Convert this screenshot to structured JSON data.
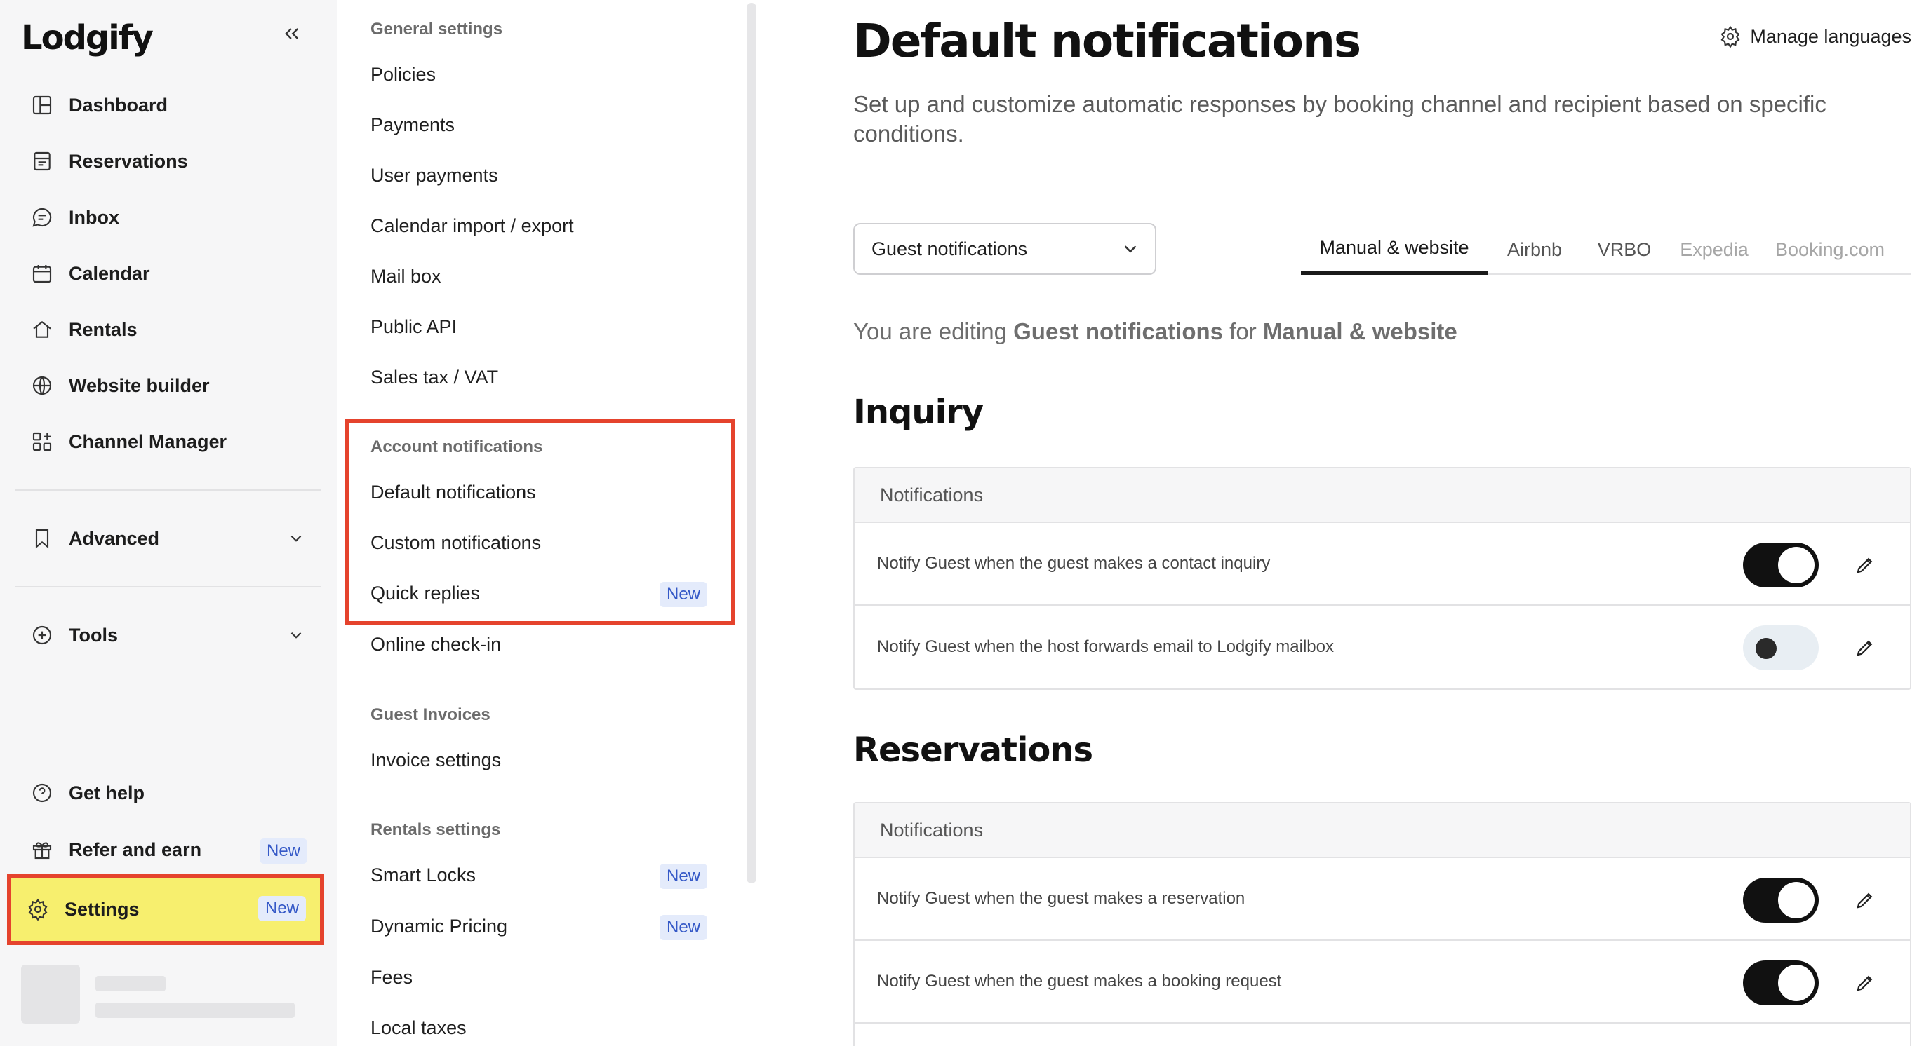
{
  "sidebar": {
    "logo": "Lodgify",
    "nav": [
      {
        "label": "Dashboard",
        "icon": "dashboard-icon"
      },
      {
        "label": "Reservations",
        "icon": "reservations-icon"
      },
      {
        "label": "Inbox",
        "icon": "inbox-icon"
      },
      {
        "label": "Calendar",
        "icon": "calendar-icon"
      },
      {
        "label": "Rentals",
        "icon": "home-icon"
      },
      {
        "label": "Website builder",
        "icon": "globe-icon"
      },
      {
        "label": "Channel Manager",
        "icon": "grid-plus-icon"
      }
    ],
    "advanced": "Advanced",
    "tools": "Tools",
    "get_help": "Get help",
    "refer": "Refer and earn",
    "refer_badge": "New",
    "settings": "Settings",
    "settings_badge": "New"
  },
  "menu": {
    "general_heading": "General settings",
    "general_items": [
      "Policies",
      "Payments",
      "User payments",
      "Calendar import / export",
      "Mail box",
      "Public API",
      "Sales tax / VAT"
    ],
    "account_heading": "Account notifications",
    "account_items": [
      "Default notifications",
      "Custom notifications",
      "Quick replies"
    ],
    "quick_replies_badge": "New",
    "online_checkin": "Online check-in",
    "invoices_heading": "Guest Invoices",
    "invoice_settings": "Invoice settings",
    "rentals_heading": "Rentals settings",
    "smart_locks": "Smart Locks",
    "smart_locks_badge": "New",
    "dynamic_pricing": "Dynamic Pricing",
    "dynamic_pricing_badge": "New",
    "fees": "Fees",
    "local_taxes": "Local taxes"
  },
  "main": {
    "title": "Default notifications",
    "manage_languages": "Manage languages",
    "subtitle": "Set up and customize automatic responses by booking channel and recipient based on specific conditions.",
    "select_value": "Guest notifications",
    "tabs": [
      "Manual & website",
      "Airbnb",
      "VRBO",
      "Expedia",
      "Booking.com"
    ],
    "editing_prefix": "You are editing ",
    "editing_target": "Guest notifications",
    "editing_mid": " for ",
    "editing_channel": "Manual & website",
    "inquiry": {
      "title": "Inquiry",
      "header": "Notifications",
      "rows": [
        {
          "text": "Notify Guest when the guest makes a contact inquiry",
          "enabled": true
        },
        {
          "text": "Notify Guest when the host forwards email to Lodgify mailbox",
          "enabled": false
        }
      ]
    },
    "reservations": {
      "title": "Reservations",
      "header": "Notifications",
      "rows": [
        {
          "text": "Notify Guest when the guest makes a reservation",
          "enabled": true
        },
        {
          "text": "Notify Guest when the guest makes a booking request",
          "enabled": true
        }
      ]
    }
  },
  "colors": {
    "highlight_border": "#e5432d",
    "highlight_fill": "#f7ef6e",
    "badge_bg": "#e4ebfb",
    "badge_text": "#3559c7"
  }
}
